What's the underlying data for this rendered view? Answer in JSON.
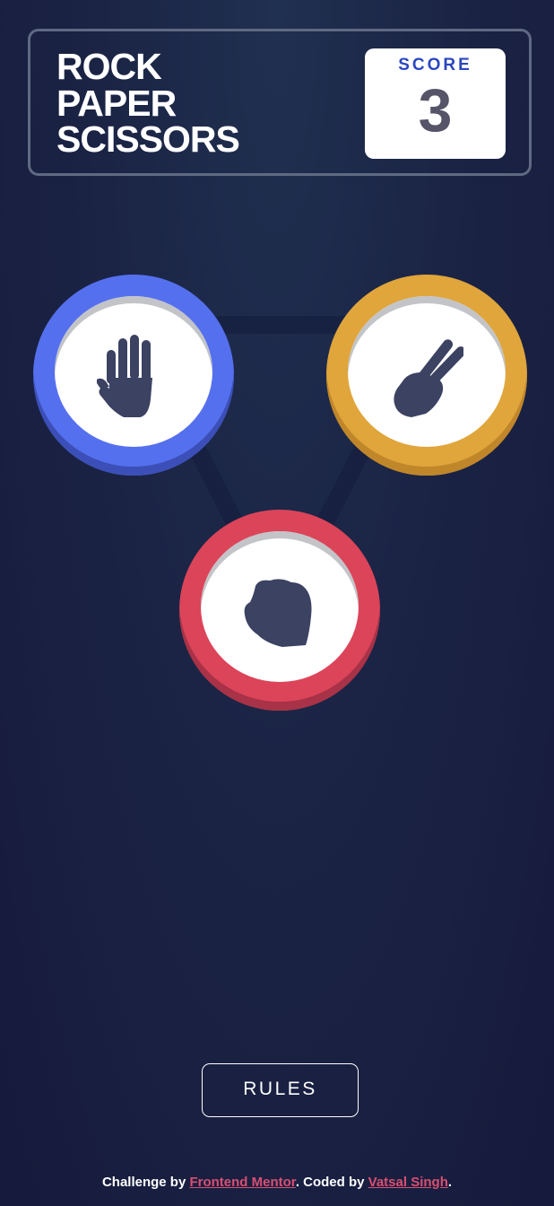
{
  "header": {
    "title_lines": [
      "ROCK",
      "PAPER",
      "SCISSORS"
    ],
    "score_label": "SCORE",
    "score_value": "3"
  },
  "game": {
    "choices": [
      {
        "id": "paper",
        "icon": "paper-hand-icon",
        "ring_color": "#5570ee"
      },
      {
        "id": "scissors",
        "icon": "scissors-hand-icon",
        "ring_color": "#e0a53b"
      },
      {
        "id": "rock",
        "icon": "rock-fist-icon",
        "ring_color": "#dc4459"
      }
    ]
  },
  "rules_button": {
    "label": "RULES"
  },
  "footer": {
    "prefix": "Challenge by",
    "link1": "Frontend Mentor",
    "middle": ". Coded by",
    "link2": "Vatsal Singh",
    "suffix": "."
  },
  "colors": {
    "background": "#1b2445",
    "score_label": "#2a46c0",
    "score_value": "#565468",
    "hand_icon": "#3b4262",
    "link": "#d94f72"
  }
}
